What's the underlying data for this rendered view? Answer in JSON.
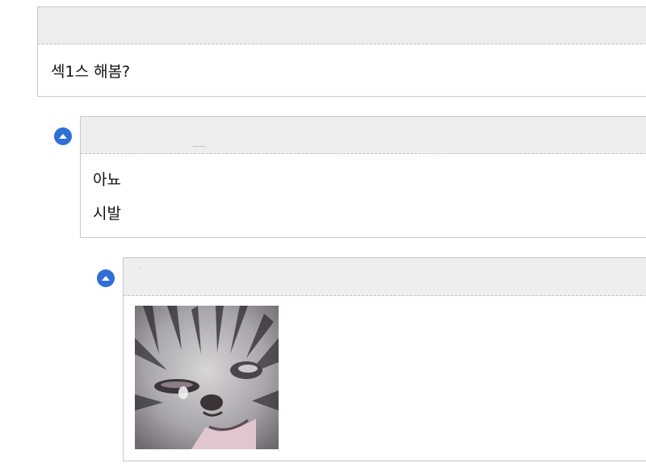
{
  "comments": [
    {
      "level": 0,
      "lines": [
        "섹1스 해봄?"
      ]
    },
    {
      "level": 1,
      "lines": [
        "아뇨",
        "시발"
      ]
    },
    {
      "level": 2,
      "lines": [],
      "image": "crying-kitten-meme"
    }
  ],
  "toggle": {
    "icon": "caret-up-icon",
    "color": "#2f6fd6"
  }
}
